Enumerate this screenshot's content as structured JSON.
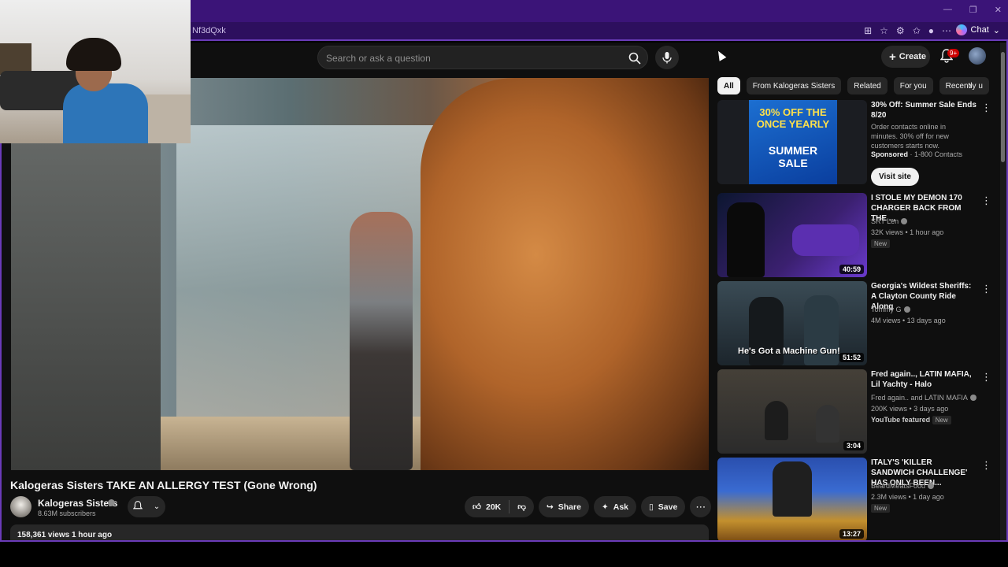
{
  "browser": {
    "url_fragment": "Nf3dQxk",
    "chat_label": "Chat"
  },
  "masthead": {
    "search_placeholder": "Search or ask a question",
    "create_label": "Create",
    "notifications_badge": "9+"
  },
  "video": {
    "title": "Kalogeras Sisters TAKE AN ALLERGY TEST (Gone Wrong)",
    "channel": "Kalogeras Sisters",
    "subscribers": "8.63M subscribers",
    "likes": "20K",
    "share_label": "Share",
    "ask_label": "Ask",
    "save_label": "Save",
    "views_time": "158,361 views  1 hour ago"
  },
  "chips": [
    "All",
    "From Kalogeras Sisters",
    "Related",
    "For you",
    "Recently u"
  ],
  "recommendations": [
    {
      "title": "30% Off: Summer Sale Ends 8/20",
      "desc": "Order contacts online in minutes. 30% off for new customers starts now.",
      "sponsor": "Sponsored",
      "channel": "1-800 Contacts",
      "cta": "Visit site",
      "thumb_top": "30% OFF THE ONCE YEARLY",
      "thumb_bottom": "SUMMER SALE"
    },
    {
      "title": "I STOLE MY DEMON 170 CHARGER BACK FROM THE ...",
      "channel": "SRT Len",
      "meta": "32K views • 1 hour ago",
      "badge": "New",
      "duration": "40:59"
    },
    {
      "title": "Georgia's Wildest Sheriffs: A Clayton County Ride Along",
      "channel": "Tommy G",
      "meta": "4M views • 13 days ago",
      "duration": "51:52",
      "thumb_caption": "He's Got a Machine Gun!"
    },
    {
      "title": "Fred again.., LATIN MAFIA, Lil Yachty - Halo",
      "channel": "Fred again.. and LATIN MAFIA",
      "meta": "200K views • 3 days ago",
      "featured": "YouTube featured",
      "badge": "New",
      "duration": "3:04"
    },
    {
      "title": "ITALY'S 'KILLER SANDWICH CHALLENGE' HAS ONLY BEEN...",
      "channel": "BeardMeatsFood",
      "meta": "2.3M views • 1 day ago",
      "badge": "New",
      "duration": "13:27"
    }
  ],
  "colors": {
    "browser_purple": "#3b1478",
    "page_bg": "#0f0f0f",
    "pill_bg": "#272727"
  }
}
